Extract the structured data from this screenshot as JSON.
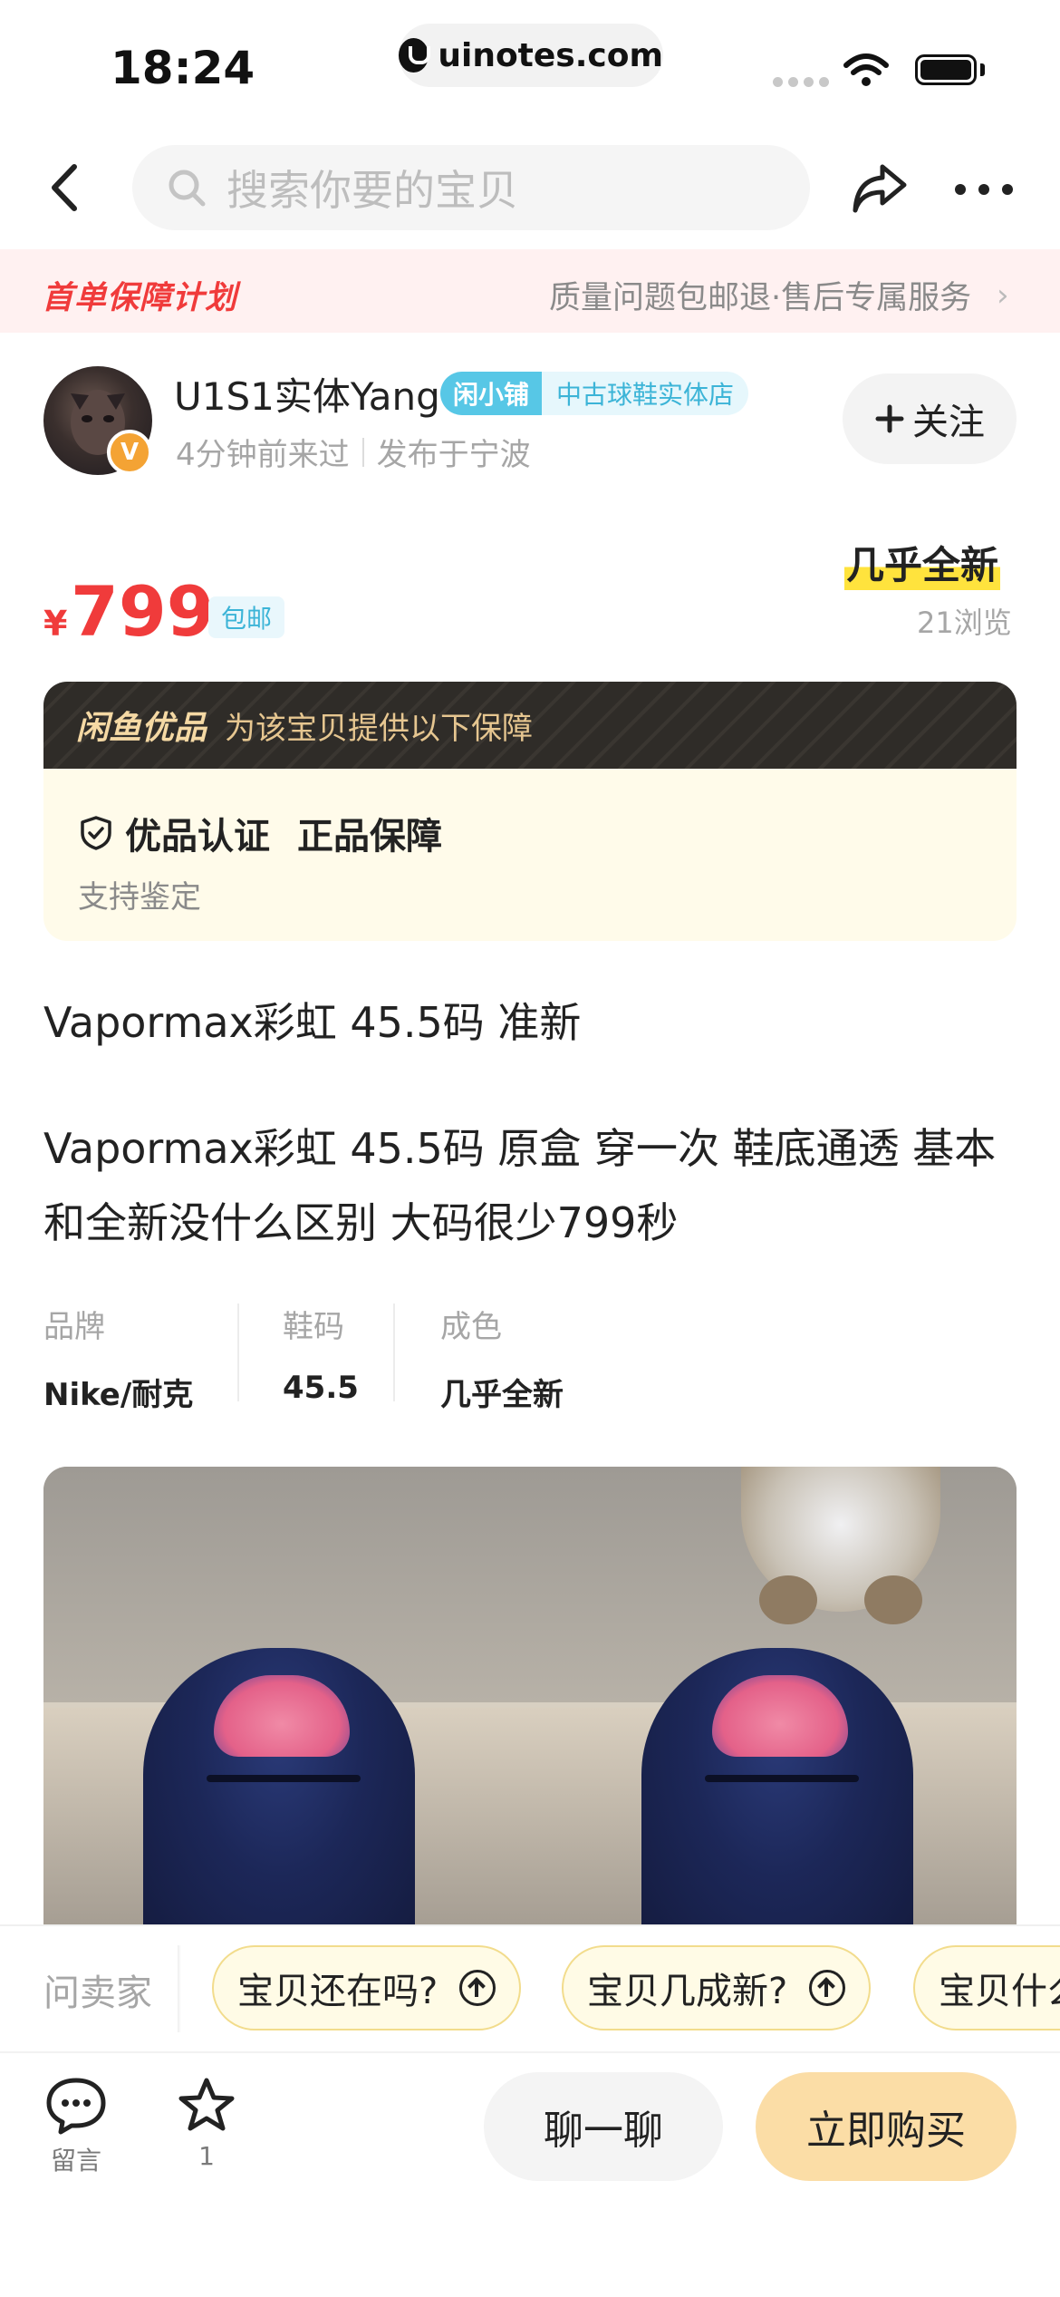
{
  "status_bar": {
    "time": "18:24",
    "url": "uinotes.com"
  },
  "nav": {
    "search_placeholder": "搜索你要的宝贝"
  },
  "protection": {
    "left": "首单保障计划",
    "right": "质量问题包邮退·售后专属服务"
  },
  "seller": {
    "name": "U1S1实体Yang",
    "shop_badge": "闲小铺",
    "shop_name": "中古球鞋实体店",
    "last_seen": "4分钟前来过",
    "location": "发布于宁波",
    "avatar_badge": "V",
    "follow_label": "关注"
  },
  "price": {
    "currency": "¥",
    "value": "799",
    "shipping": "包邮",
    "condition": "几乎全新",
    "views": "21浏览"
  },
  "guarantee": {
    "brand": "闲鱼优品",
    "subtitle": "为该宝贝提供以下保障",
    "items": [
      "优品认证",
      "正品保障"
    ],
    "note": "支持鉴定"
  },
  "item": {
    "title": "Vapormax彩虹 45.5码 准新",
    "description": "Vapormax彩虹 45.5码 原盒 穿一次 鞋底通透 基本和全新没什么区别 大码很少799秒",
    "specs": [
      {
        "key": "品牌",
        "value": "Nike/耐克"
      },
      {
        "key": "鞋码",
        "value": "45.5"
      },
      {
        "key": "成色",
        "value": "几乎全新"
      }
    ]
  },
  "ask": {
    "label": "问卖家",
    "chips": [
      "宝贝还在吗?",
      "宝贝几成新?",
      "宝贝什么"
    ]
  },
  "bottom": {
    "comment_label": "留言",
    "fav_count": "1",
    "chat_label": "聊一聊",
    "buy_label": "立即购买"
  },
  "colors": {
    "accent_red": "#f03b3b",
    "buy_button": "#fbdda6",
    "shop_tag": "#57c7e6"
  }
}
